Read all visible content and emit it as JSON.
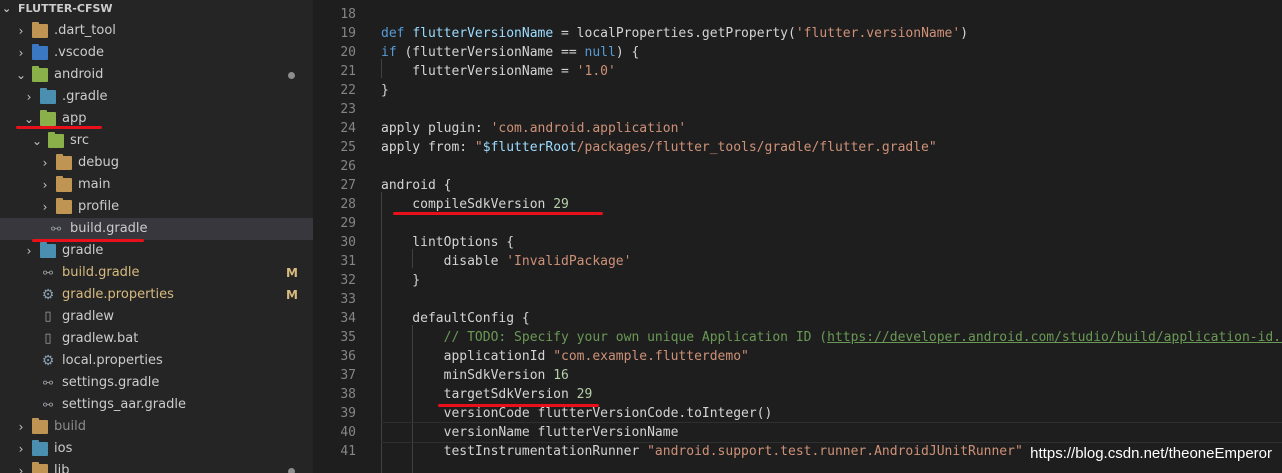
{
  "explorer": {
    "header": "FLUTTER-CFSW",
    "items": [
      {
        "label": ".dart_tool",
        "icon": "folder-icon",
        "chev": "›",
        "depth": 0
      },
      {
        "label": ".vscode",
        "icon": "vscode-folder-icon",
        "chev": "›",
        "depth": 0
      },
      {
        "label": "android",
        "icon": "android-folder-icon",
        "chev": "⌄",
        "depth": 0,
        "dot": true
      },
      {
        "label": ".gradle",
        "icon": "gradle-folder-icon",
        "chev": "›",
        "depth": 1
      },
      {
        "label": "app",
        "icon": "app-folder-icon",
        "chev": "⌄",
        "depth": 1
      },
      {
        "label": "src",
        "icon": "src-folder-icon",
        "chev": "⌄",
        "depth": 2
      },
      {
        "label": "debug",
        "icon": "folder-icon",
        "chev": "›",
        "depth": 3
      },
      {
        "label": "main",
        "icon": "folder-icon",
        "chev": "›",
        "depth": 3
      },
      {
        "label": "profile",
        "icon": "folder-icon",
        "chev": "›",
        "depth": 3
      },
      {
        "label": "build.gradle",
        "icon": "gradle-file-icon",
        "chev": "",
        "depth": 2,
        "selected": true
      },
      {
        "label": "gradle",
        "icon": "gradle-folder-icon",
        "chev": "›",
        "depth": 1
      },
      {
        "label": "build.gradle",
        "icon": "gradle-file-icon",
        "chev": "",
        "depth": 1,
        "badge": "M",
        "color": "#d7ba7d"
      },
      {
        "label": "gradle.properties",
        "icon": "gear-icon",
        "chev": "",
        "depth": 1,
        "badge": "M",
        "color": "#d7ba7d"
      },
      {
        "label": "gradlew",
        "icon": "file-icon",
        "chev": "",
        "depth": 1
      },
      {
        "label": "gradlew.bat",
        "icon": "file-icon",
        "chev": "",
        "depth": 1
      },
      {
        "label": "local.properties",
        "icon": "gear-icon",
        "chev": "",
        "depth": 1
      },
      {
        "label": "settings.gradle",
        "icon": "gradle-file-icon",
        "chev": "",
        "depth": 1
      },
      {
        "label": "settings_aar.gradle",
        "icon": "gradle-file-icon",
        "chev": "",
        "depth": 1
      },
      {
        "label": "build",
        "icon": "folder-icon",
        "chev": "›",
        "depth": 0,
        "color": "#8c8c8c"
      },
      {
        "label": "ios",
        "icon": "ios-folder-icon",
        "chev": "›",
        "depth": 0
      },
      {
        "label": "lib",
        "icon": "folder-icon",
        "chev": "›",
        "depth": 0,
        "dot": true
      }
    ]
  },
  "editor": {
    "line_numbers": [
      "18",
      "19",
      "20",
      "21",
      "22",
      "23",
      "24",
      "25",
      "26",
      "27",
      "28",
      "29",
      "30",
      "31",
      "32",
      "33",
      "34",
      "35",
      "36",
      "37",
      "38",
      "39",
      "40",
      "41"
    ],
    "lines": [
      [],
      [
        [
          "kw",
          "def "
        ],
        [
          "var",
          "flutterVersionName"
        ],
        [
          "plain",
          " = localProperties.getProperty("
        ],
        [
          "str",
          "'flutter.versionName'"
        ],
        [
          "plain",
          ")"
        ]
      ],
      [
        [
          "kw",
          "if"
        ],
        [
          "plain",
          " (flutterVersionName == "
        ],
        [
          "kw",
          "null"
        ],
        [
          "plain",
          ") {"
        ]
      ],
      [
        [
          "plain",
          "    flutterVersionName = "
        ],
        [
          "str",
          "'1.0'"
        ]
      ],
      [
        [
          "plain",
          "}"
        ]
      ],
      [],
      [
        [
          "plain",
          "apply plugin: "
        ],
        [
          "str",
          "'com.android.application'"
        ]
      ],
      [
        [
          "plain",
          "apply from: "
        ],
        [
          "str",
          "\""
        ],
        [
          "var",
          "$flutterRoot"
        ],
        [
          "str",
          "/packages/flutter_tools/gradle/flutter.gradle\""
        ]
      ],
      [],
      [
        [
          "plain",
          "android {"
        ]
      ],
      [
        [
          "plain",
          "    compileSdkVersion "
        ],
        [
          "num",
          "29"
        ]
      ],
      [],
      [
        [
          "plain",
          "    lintOptions {"
        ]
      ],
      [
        [
          "plain",
          "        disable "
        ],
        [
          "str",
          "'InvalidPackage'"
        ]
      ],
      [
        [
          "plain",
          "    }"
        ]
      ],
      [],
      [
        [
          "plain",
          "    defaultConfig {"
        ]
      ],
      [
        [
          "cm",
          "        // TODO: Specify your own unique Application ID ("
        ],
        [
          "url",
          "https://developer.android.com/studio/build/application-id.ht"
        ]
      ],
      [
        [
          "plain",
          "        applicationId "
        ],
        [
          "str",
          "\"com.example.flutterdemo\""
        ]
      ],
      [
        [
          "plain",
          "        minSdkVersion "
        ],
        [
          "num",
          "16"
        ]
      ],
      [
        [
          "plain",
          "        targetSdkVersion "
        ],
        [
          "num",
          "29"
        ]
      ],
      [
        [
          "plain",
          "        versionCode flutterVersionCode.toInteger()"
        ]
      ],
      [
        [
          "plain",
          "        versionName flutterVersionName"
        ]
      ],
      [
        [
          "plain",
          "        testInstrumentationRunner "
        ],
        [
          "str",
          "\"android.support.test.runner.AndroidJUnitRunner\""
        ]
      ]
    ]
  },
  "watermark": "https://blog.csdn.net/theoneEmperor",
  "colors": {
    "annotation_red": "#e8101a",
    "modified_badge": "#d7ba7d",
    "keyword": "#569cd6",
    "string": "#ce9178",
    "number": "#b5cea8",
    "comment": "#6a9955"
  }
}
